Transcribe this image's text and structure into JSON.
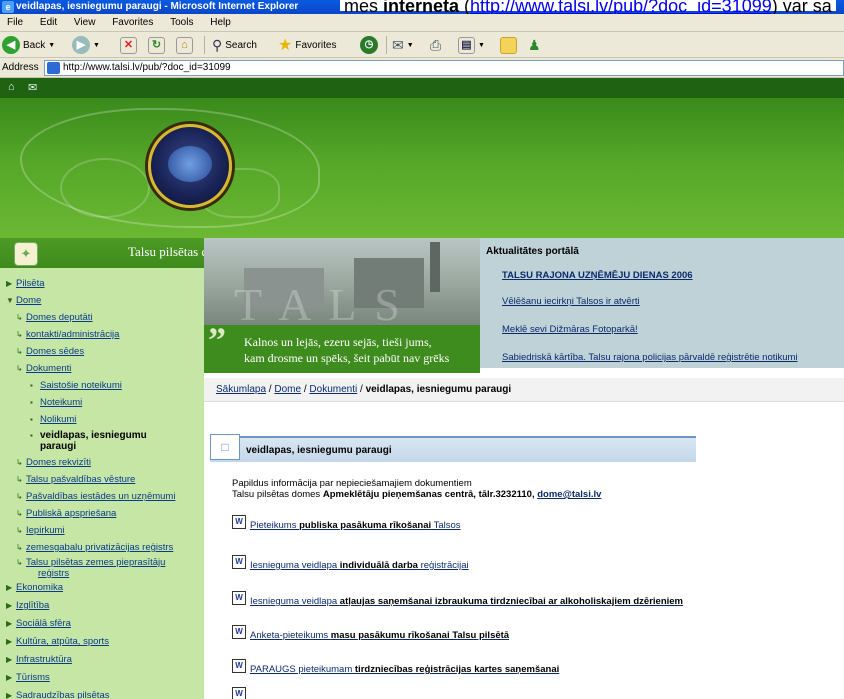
{
  "window": {
    "title": "veidlapas, iesniegumu paraugi - Microsoft Internet Explorer",
    "doc_behind_prefix": "mes ",
    "doc_behind_bold": "interneta",
    "doc_behind_link": "http://www.talsi.lv/pub/?doc_id=31099",
    "doc_behind_suffix": " var sa"
  },
  "menu": [
    "File",
    "Edit",
    "View",
    "Favorites",
    "Tools",
    "Help"
  ],
  "toolbar": {
    "back_label": "Back",
    "search_label": "Search",
    "favorites_label": "Favorites"
  },
  "address": {
    "label": "Address",
    "url": "http://www.talsi.lv/pub/?doc_id=31099"
  },
  "site": {
    "name": "Talsu pilsētas dome"
  },
  "slogan": {
    "quote_mark": "”",
    "line1": "Kalnos un lejās, ezeru sejās, tieši jums,",
    "line2": "kam drosme un spēks, šeit pabūt nav grēks"
  },
  "news": {
    "title": "Aktualitātes portālā",
    "items": [
      "TALSU RAJONA UZŅĒMĒJU DIENAS 2006",
      "Vēlēšanu iecirkņi Talsos ir atvērti",
      "Meklē sevi Dižmāras Fotoparkā!",
      "Sabiedriskā kārtība. Talsu rajona policijas pārvaldē reģistrētie notikumi"
    ]
  },
  "nav": {
    "items": [
      {
        "label": "Pilsēta",
        "marker": "▶"
      },
      {
        "label": "Dome",
        "marker": "▼"
      },
      {
        "label": "Domes deputāti",
        "marker": "↳"
      },
      {
        "label": "kontakti/administrācija",
        "marker": "↳"
      },
      {
        "label": "Domes sēdes",
        "marker": "↳"
      },
      {
        "label": "Dokumenti",
        "marker": "↳"
      },
      {
        "label": "Saistošie noteikumi",
        "marker": "▪"
      },
      {
        "label": "Noteikumi",
        "marker": "▪"
      },
      {
        "label": "Nolikumi",
        "marker": "▪"
      },
      {
        "label": "veidlapas, iesniegumu",
        "marker": "▪"
      },
      {
        "label": "paraugi",
        "marker": ""
      },
      {
        "label": "Domes rekvizīti",
        "marker": "↳"
      },
      {
        "label": "Talsu pašvaldības vēsture",
        "marker": "↳"
      },
      {
        "label": "Pašvaldības iestādes un uzņēmumi",
        "marker": "↳"
      },
      {
        "label": "Publiskā apspriešana",
        "marker": "↳"
      },
      {
        "label": "Iepirkumi",
        "marker": "↳"
      },
      {
        "label": "zemesgabalu privatizācijas reģistrs",
        "marker": "↳"
      },
      {
        "label": "Talsu pilsētas zemes pieprasītāju",
        "marker": "↳"
      },
      {
        "label": "reģistrs",
        "marker": ""
      },
      {
        "label": "Ekonomika",
        "marker": "▶"
      },
      {
        "label": "Izglītība",
        "marker": "▶"
      },
      {
        "label": "Sociālā sfēra",
        "marker": "▶"
      },
      {
        "label": "Kultūra, atpūta, sports",
        "marker": "▶"
      },
      {
        "label": "Infrastruktūra",
        "marker": "▶"
      },
      {
        "label": "Tūrisms",
        "marker": "▶"
      },
      {
        "label": "Sadraudzības pilsētas",
        "marker": "▶"
      }
    ]
  },
  "breadcrumb": {
    "items": [
      "Sākumlapa",
      "Dome",
      "Dokumenti"
    ],
    "separator": " / ",
    "current": "veidlapas, iesniegumu paraugi"
  },
  "section": {
    "title": "veidlapas, iesniegumu paraugi"
  },
  "intro": {
    "line1": "Papildus informācija par nepieciešamajiem dokumentiem",
    "line2_prefix": "Talsu pilsētas domes ",
    "line2_bold": "Apmeklētāju pieņemšanas centrā, tālr.3232110, ",
    "email": "dome@talsi.lv"
  },
  "documents": [
    {
      "prefix": "Pieteikums ",
      "bold": "publiska pasākuma rīkošanai",
      "suffix": " Talsos"
    },
    {
      "prefix": "Iesnieguma veidlapa ",
      "bold": "individuālā darba",
      "suffix": " reģistrācijai"
    },
    {
      "prefix": "Iesnieguma veidlapa ",
      "bold": "atļaujas saņemšanai izbraukuma tirdzniecībai ar alkoholiskajiem dzērieniem",
      "suffix": ""
    },
    {
      "prefix": "Anketa-pieteikums ",
      "bold": "masu pasākumu rīkošanai Talsu pilsētā",
      "suffix": ""
    },
    {
      "prefix": "PARAUGS pieteikumam ",
      "bold": "tirdzniecības reģistrācijas kartes saņemšanai",
      "suffix": ""
    }
  ],
  "icons": {
    "word_doc_glyph": "W"
  }
}
